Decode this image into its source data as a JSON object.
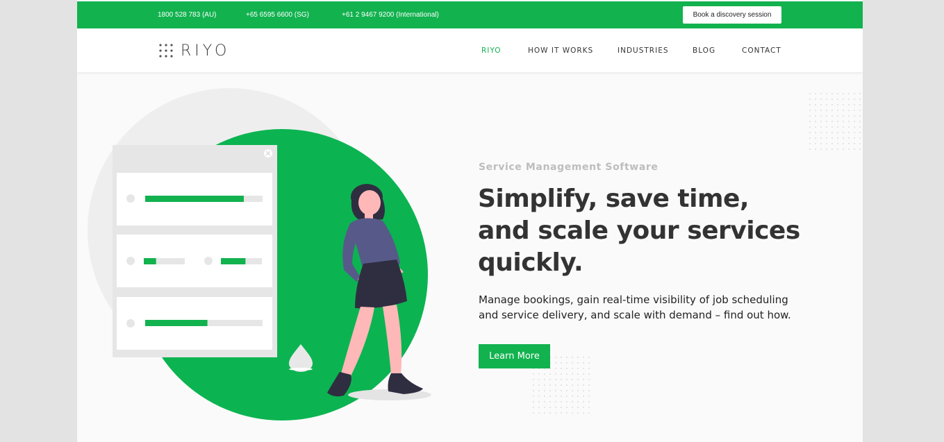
{
  "topbar": {
    "phones": [
      "1800 528 783 (AU)",
      "+65 6595 6600 (SG)",
      "+61 2 9467 9200 (International)"
    ],
    "book_label": "Book a discovery session"
  },
  "nav": {
    "logo_text": "RIYO",
    "items": [
      "RIYO",
      "HOW IT WORKS",
      "INDUSTRIES",
      "BLOG",
      "CONTACT"
    ],
    "active": "RIYO"
  },
  "hero": {
    "subtitle": "Service Management  Software",
    "title": "Simplify, save time, and scale your services quickly.",
    "description": "Manage bookings, gain real-time visibility of job scheduling and service delivery, and scale with demand – find out how.",
    "cta_label": "Learn More"
  },
  "illustration": {
    "panel_rows": [
      {
        "bars": [
          {
            "fill": 0.84
          }
        ]
      },
      {
        "bars": [
          {
            "fill": 0.3
          },
          {
            "fill": 0.6
          }
        ]
      },
      {
        "bars": [
          {
            "fill": 0.53
          }
        ]
      }
    ]
  },
  "colors": {
    "brand": "#12b24f",
    "text": "#333333",
    "muted": "#bdbdbd",
    "page_bg": "#fafafa",
    "outer_bg": "#e3e3e3"
  },
  "icons": [
    "close-icon",
    "logo-dots-icon"
  ]
}
